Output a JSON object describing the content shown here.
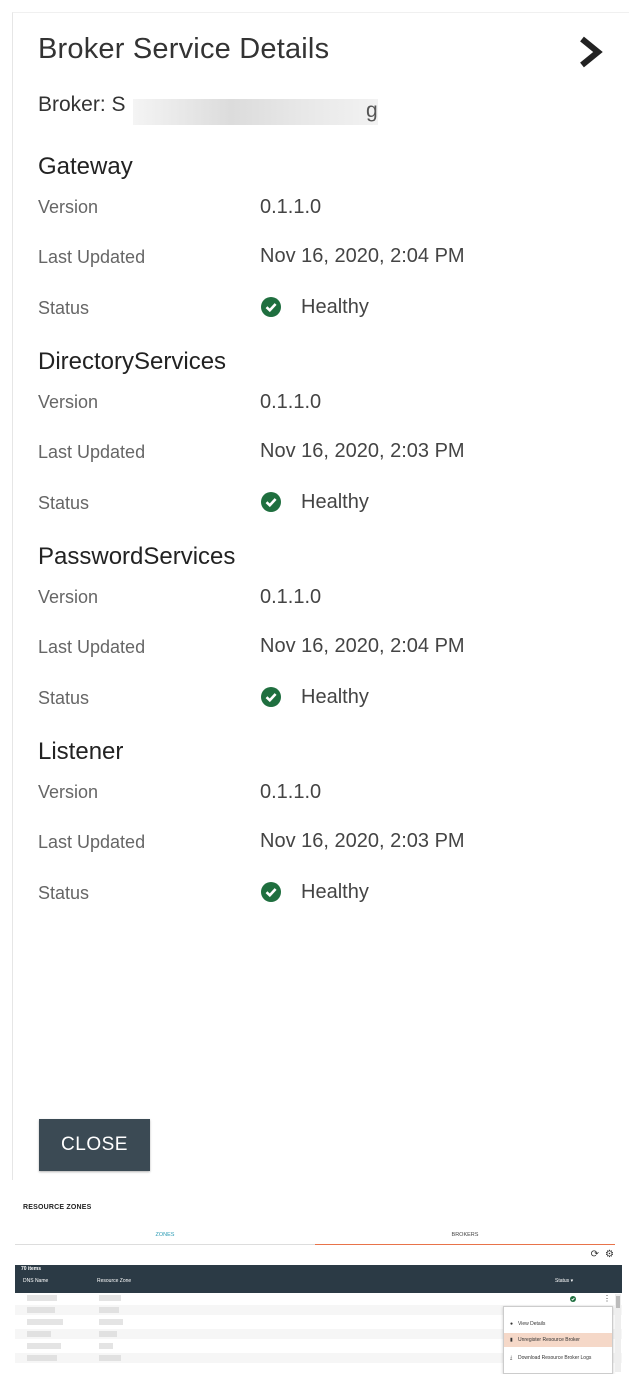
{
  "panel": {
    "title": "Broker Service Details",
    "broker_prefix": "Broker: S",
    "broker_suffix": "g",
    "close_label": "CLOSE",
    "check_color": "#1f6f3f"
  },
  "services": [
    {
      "name": "Gateway",
      "version_label": "Version",
      "version": "0.1.1.0",
      "updated_label": "Last Updated",
      "updated": "Nov 16, 2020, 2:04 PM",
      "status_label": "Status",
      "status": "Healthy"
    },
    {
      "name": "DirectoryServices",
      "version_label": "Version",
      "version": "0.1.1.0",
      "updated_label": "Last Updated",
      "updated": "Nov 16, 2020, 2:03 PM",
      "status_label": "Status",
      "status": "Healthy"
    },
    {
      "name": "PasswordServices",
      "version_label": "Version",
      "version": "0.1.1.0",
      "updated_label": "Last Updated",
      "updated": "Nov 16, 2020, 2:04 PM",
      "status_label": "Status",
      "status": "Healthy"
    },
    {
      "name": "Listener",
      "version_label": "Version",
      "version": "0.1.1.0",
      "updated_label": "Last Updated",
      "updated": "Nov 16, 2020, 2:03 PM",
      "status_label": "Status",
      "status": "Healthy"
    }
  ],
  "resource_zones": {
    "title": "RESOURCE ZONES",
    "tab_zones": "ZONES",
    "tab_brokers": "BROKERS",
    "items_count": "70 items",
    "col_dns": "DNS Name",
    "col_zone": "Resource Zone",
    "col_status": "Status ▾",
    "accent": "#e8734a",
    "menu": {
      "view_details": "View Details",
      "unregister": "Unregister Resource Broker",
      "download_logs": "Download Resource Broker Logs"
    }
  }
}
